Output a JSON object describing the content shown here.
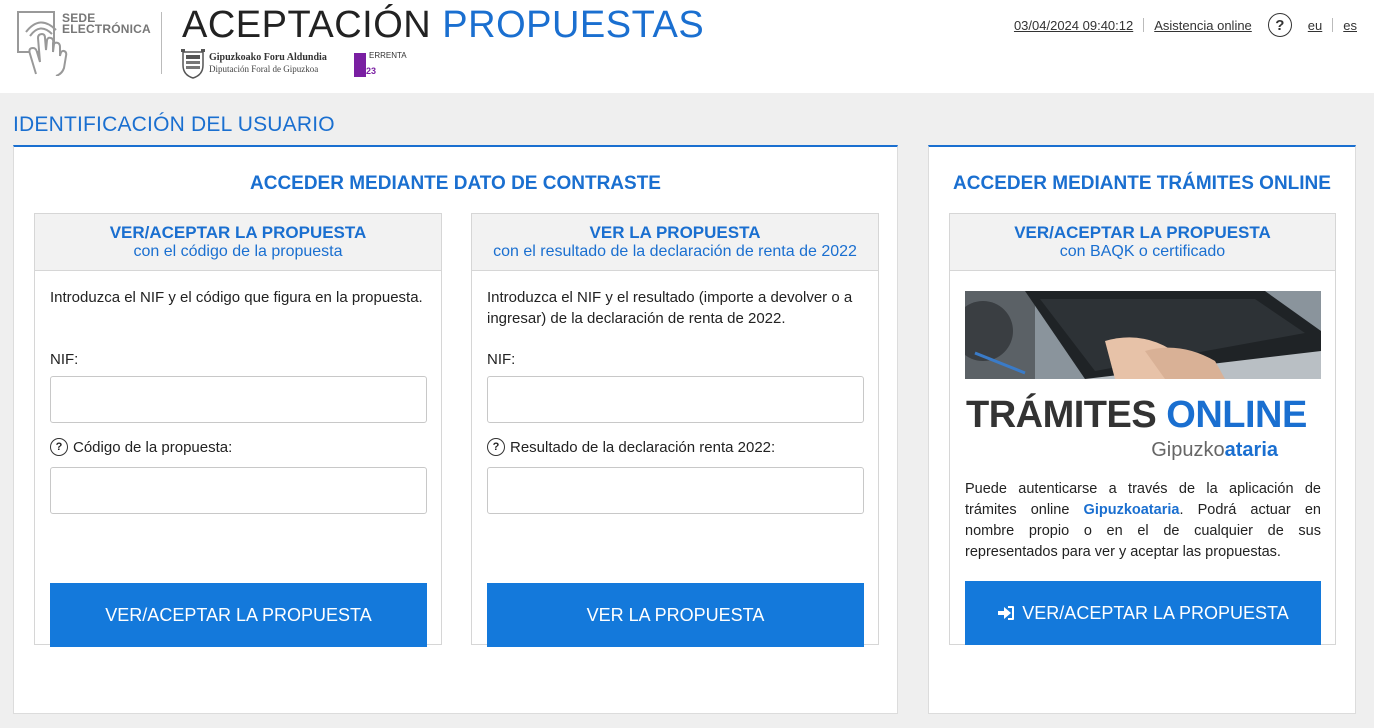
{
  "header": {
    "sede_line1": "SEDE",
    "sede_line2": "ELECTRÓNICA",
    "title_part1": "ACEPTACIÓN",
    "title_part2": "PROPUESTAS",
    "gfa_name1": "Gipuzkoako Foru Aldundia",
    "gfa_name2": "Diputación Foral de Gipuzkoa",
    "errenta_label": "ERRENTA",
    "errenta_year": "2023",
    "datetime": "03/04/2024 09:40:12",
    "assist_link": "Asistencia online",
    "help_symbol": "?",
    "lang_eu": "eu",
    "lang_es": "es"
  },
  "section_title": "IDENTIFICACIÓN DEL USUARIO",
  "left_panel": {
    "heading": "ACCEDER MEDIANTE DATO DE CONTRASTE",
    "card1": {
      "title": "VER/ACEPTAR LA PROPUESTA",
      "subtitle": "con el código de la propuesta",
      "intro": "Introduzca el NIF y el código que figura en la propuesta.",
      "nif_label": "NIF:",
      "code_label": "Código de la propuesta:",
      "button": "VER/ACEPTAR LA PROPUESTA"
    },
    "card2": {
      "title": "VER LA PROPUESTA",
      "subtitle": "con el resultado de la declaración de renta de 2022",
      "intro": "Introduzca el NIF y el resultado (importe a devolver o a ingresar) de la declaración de renta de 2022.",
      "nif_label": "NIF:",
      "result_label": "Resultado de la declaración renta 2022:",
      "button": "VER LA PROPUESTA"
    }
  },
  "right_panel": {
    "heading": "ACCEDER MEDIANTE TRÁMITES ONLINE",
    "card3": {
      "title": "VER/ACEPTAR LA PROPUESTA",
      "subtitle": "con BAQK o certificado",
      "logo_word1": "TRÁMITES",
      "logo_word2": "ONLINE",
      "logo_brand1": "Gipuzko",
      "logo_brand2": "ataria",
      "desc_before": "Puede autenticarse a través de la aplicación de trámites online ",
      "desc_strong": "Gipuzkoataria",
      "desc_after": ". Podrá actuar en nombre propio o en el de cualquier de sus representados para ver y aceptar las propuestas.",
      "button": "VER/ACEPTAR LA PROPUESTA"
    }
  },
  "colors": {
    "accent": "#1a6fd0",
    "button": "#1479db",
    "errenta": "#7a1fa2"
  },
  "icons": {
    "sede": "hand-touch-icon",
    "help": "question-circle-icon",
    "login": "sign-in-icon"
  }
}
